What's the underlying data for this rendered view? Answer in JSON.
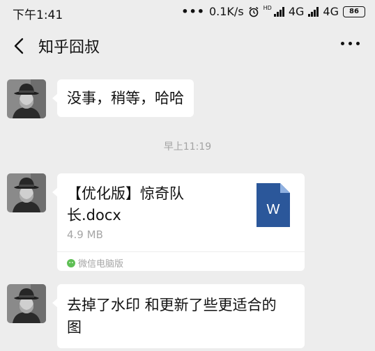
{
  "status_bar": {
    "time": "下午1:41",
    "dots": "•••",
    "net_speed": "0.1K/s",
    "hd_label": "HD",
    "network1": "4G",
    "network2": "4G",
    "battery": "86",
    "icons": [
      "alarm-icon",
      "signal-icon",
      "battery-icon"
    ]
  },
  "header": {
    "title": "知乎囧叔",
    "back_icon": "chevron-left-icon",
    "more_icon": "more-dots-icon"
  },
  "messages": [
    {
      "type": "text",
      "text": "没事，稍等，哈哈"
    },
    {
      "type": "timestamp",
      "text": "早上11:19"
    },
    {
      "type": "file",
      "name_line1": "【优化版】惊奇队",
      "name_line2": "长.docx",
      "size": "4.9 MB",
      "icon_letter": "W",
      "source": "微信电脑版"
    },
    {
      "type": "text",
      "text_line1": "去掉了水印 和更新了些更适合的",
      "text_line2": "图"
    }
  ],
  "colors": {
    "background": "#ededed",
    "bubble": "#ffffff",
    "word_blue": "#2b579a",
    "muted_text": "#a6a6a6"
  }
}
